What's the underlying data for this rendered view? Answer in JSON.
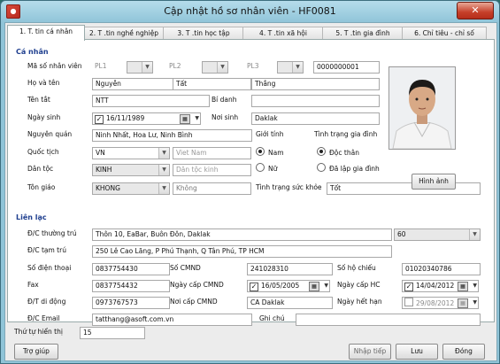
{
  "window": {
    "title": "Cập nhật hồ sơ nhân viên - HF0081",
    "close_label": "✕"
  },
  "tabs": [
    "1. T. tin cá nhân",
    "2. T .tin nghề nghiệp",
    "3. T .tin học tập",
    "4. T .tin xã hội",
    "5. T .tin gia đình",
    "6. Chỉ tiêu - chỉ số"
  ],
  "personal": {
    "section_label": "Cá nhân",
    "employee_id_label": "Mã số nhân viên",
    "pl1_label": "PL1",
    "pl2_label": "PL2",
    "pl3_label": "PL3",
    "employee_id_value": "0000000001",
    "name_label": "Họ và tên",
    "last_name": "Nguyễn",
    "middle_name": "Tất",
    "first_name": "Thắng",
    "alias_label": "Tên tắt",
    "alias_value": "NTT",
    "nickname_label": "Bí danh",
    "nickname_value": "",
    "birthdate_label": "Ngày sinh",
    "birthdate_value": "16/11/1989",
    "birthplace_label": "Nơi sinh",
    "birthplace_value": "Daklak",
    "hometown_label": "Nguyên quán",
    "hometown_value": "Ninh Nhất, Hoa Lư, Ninh Bình",
    "gender_label": "Giới tính",
    "gender_male": "Nam",
    "gender_female": "Nữ",
    "marital_label": "Tình trạng gia đình",
    "marital_single": "Độc thân",
    "marital_married": "Đã lập gia đình",
    "nationality_label": "Quốc tịch",
    "nationality_code": "VN",
    "nationality_name": "Viet Nam",
    "ethnicity_label": "Dân tộc",
    "ethnicity_code": "KINH",
    "ethnicity_placeholder": "Dân tộc kinh",
    "religion_label": "Tôn giáo",
    "religion_code": "KHONG",
    "religion_name": "Không",
    "health_label": "Tình trạng sức khỏe",
    "health_value": "Tốt",
    "photo_button": "Hình ảnh"
  },
  "contact": {
    "section_label": "Liên lạc",
    "permanent_label": "Đ/C thường trú",
    "permanent_value": "Thôn 10, EaBar, Buôn Đôn, Daklak",
    "permanent_code": "60",
    "temporary_label": "Đ/C tạm trú",
    "temporary_value": "250 Lê Cao Lãng, P Phú Thạnh, Q Tân Phú, TP HCM",
    "phone_label": "Số điện thoại",
    "phone_value": "0837754430",
    "id_number_label": "Số CMND",
    "id_number_value": "241028310",
    "passport_label": "Số hộ chiếu",
    "passport_value": "01020340786",
    "fax_label": "Fax",
    "fax_value": "0837754432",
    "id_date_label": "Ngày cấp CMND",
    "id_date_value": "16/05/2005",
    "passport_date_label": "Ngày cấp HC",
    "passport_date_value": "14/04/2012",
    "mobile_label": "Đ/T di động",
    "mobile_value": "0973767573",
    "id_place_label": "Nơi cấp CMND",
    "id_place_value": "CA Daklak",
    "expiry_label": "Ngày hết hạn",
    "expiry_value": "29/08/2012",
    "email_label": "Đ/C Email",
    "email_value": "tatthang@asoft.com.vn",
    "note_label": "Ghi chú",
    "note_value": ""
  },
  "footer": {
    "order_label": "Thứ tự hiển thị",
    "order_value": "15",
    "help_button": "Trợ giúp",
    "add_button": "Nhập tiếp",
    "save_button": "Lưu",
    "close_button": "Đóng"
  }
}
